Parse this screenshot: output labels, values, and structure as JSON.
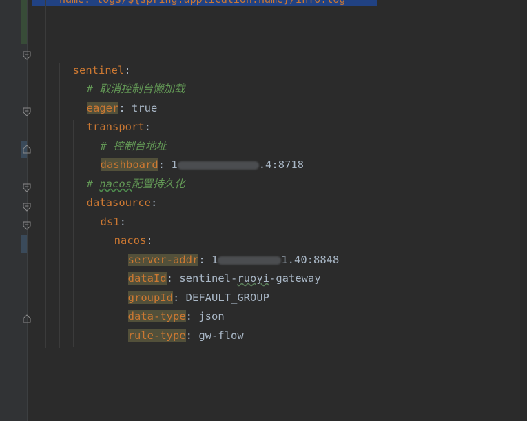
{
  "top_partial_line": "name: logs/${spring.application.name}/info.log",
  "lines": {
    "sentinel_key": "sentinel",
    "comment_eager": "# 取消控制台懒加载",
    "eager_key": "eager",
    "eager_val": "true",
    "transport_key": "transport",
    "comment_dashboard": "# 控制台地址",
    "dashboard_key": "dashboard",
    "dashboard_val_prefix": "1",
    "dashboard_val_suffix": ".4",
    "dashboard_port": ":8718",
    "comment_nacos_prefix": "# ",
    "comment_nacos_word": "nacos",
    "comment_nacos_suffix": "配置持久化",
    "datasource_key": "datasource",
    "ds1_key": "ds1",
    "nacos_key": "nacos",
    "server_addr_key": "server-addr",
    "server_addr_val_prefix": "1",
    "server_addr_val_suffix": "1.40:8848",
    "dataid_key": "dataId",
    "dataid_val_a": "sentinel-",
    "dataid_val_b": "ruoyi",
    "dataid_val_c": "-gateway",
    "groupid_key": "groupId",
    "groupid_val": "DEFAULT_GROUP",
    "datatype_key": "data-type",
    "datatype_val": "json",
    "ruletype_key": "rule-type",
    "ruletype_val": "gw-flow"
  },
  "colors": {
    "background": "#2b2b2b",
    "key": "#cc7832",
    "comment": "#629755",
    "text": "#a9b7c6",
    "selection": "#214283",
    "key_highlight": "#52503a"
  },
  "icons": [
    "fold-arrow-icon",
    "fold-end-icon"
  ]
}
